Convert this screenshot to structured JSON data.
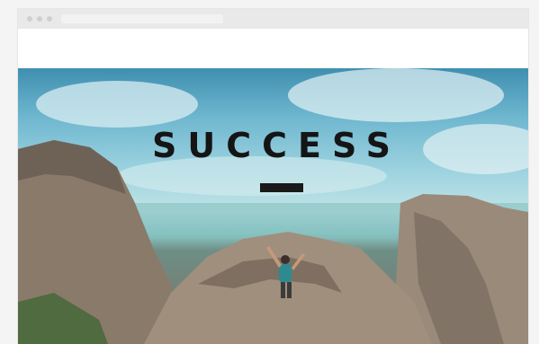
{
  "site": {
    "brand_name": "",
    "brand_tagline": ""
  },
  "nav": {
    "items": [
      "",
      "",
      "",
      "",
      ""
    ]
  },
  "hero": {
    "subtitle": "",
    "title": "SUCCESS",
    "button_label": ""
  },
  "colors": {
    "title": "#151515",
    "button": "#1a1a1a",
    "sky_top": "#3f8fb0",
    "rock": "#8a7a6a"
  },
  "icons": {
    "hiker": "person-silhouette"
  }
}
